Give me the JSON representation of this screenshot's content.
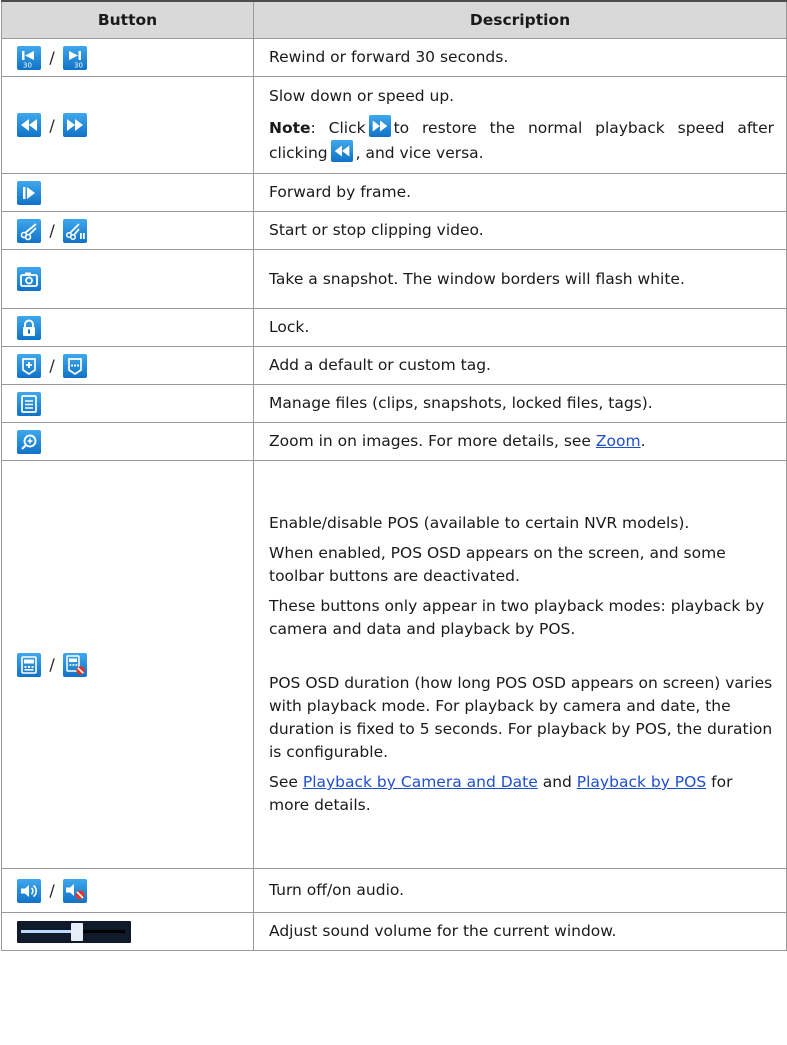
{
  "header": {
    "col1": "Button",
    "col2": "Description"
  },
  "rows": {
    "r1": {
      "icons": [
        "rewind-30-icon",
        "forward-30-icon"
      ],
      "separator": "/",
      "desc": "Rewind or forward 30 seconds."
    },
    "r2": {
      "icons": [
        "slow-down-icon",
        "speed-up-icon"
      ],
      "separator": "/",
      "desc": "Slow down or speed up.",
      "note_label": "Note",
      "note_colon": ": Click",
      "note_mid": "to restore the normal playback speed after clicking",
      "note_end": ", and vice versa."
    },
    "r3": {
      "icons": [
        "forward-frame-icon"
      ],
      "desc": "Forward by frame."
    },
    "r4": {
      "icons": [
        "start-clip-icon",
        "stop-clip-icon"
      ],
      "separator": "/",
      "desc": "Start or stop clipping video."
    },
    "r5": {
      "icons": [
        "camera-icon"
      ],
      "desc": "Take a snapshot. The window borders will flash white."
    },
    "r6": {
      "icons": [
        "lock-icon"
      ],
      "desc": "Lock."
    },
    "r7": {
      "icons": [
        "default-tag-icon",
        "custom-tag-icon"
      ],
      "separator": "/",
      "desc": "Add a default or custom tag."
    },
    "r8": {
      "icons": [
        "file-manage-icon"
      ],
      "desc": "Manage files (clips, snapshots, locked files, tags)."
    },
    "r9": {
      "icons": [
        "zoom-icon"
      ],
      "desc_prefix": "Zoom in on images. For more details, see ",
      "link": "Zoom",
      "desc_suffix": "."
    },
    "r10": {
      "icons": [
        "pos-enable-icon",
        "pos-disable-icon"
      ],
      "separator": "/",
      "p1": "Enable/disable POS (available to certain NVR models).",
      "p2": "When enabled, POS OSD appears on the screen, and some toolbar buttons are deactivated.",
      "p3": "These buttons only appear in two playback modes: playback by camera and data and playback by POS.",
      "p4": "POS OSD duration (how long POS OSD appears on screen) varies with playback mode. For playback by camera and date, the duration is fixed to 5 seconds. For playback by POS, the duration is configurable.",
      "p5_prefix": "See ",
      "link1": "Playback by Camera and Date",
      "p5_mid": " and ",
      "link2": "Playback by POS",
      "p5_suffix": " for more details."
    },
    "r11": {
      "icons": [
        "audio-on-icon",
        "audio-off-icon"
      ],
      "separator": "/",
      "desc": "Turn off/on audio."
    },
    "r12": {
      "icons": [
        "volume-slider"
      ],
      "volume_level": 0.45,
      "desc": "Adjust sound volume for the current window."
    }
  }
}
